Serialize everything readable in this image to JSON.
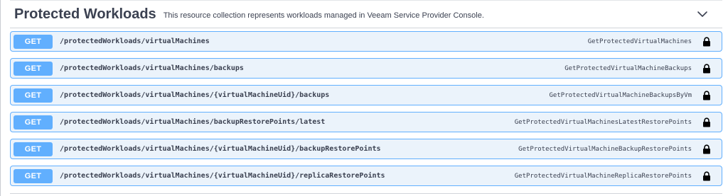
{
  "section": {
    "title": "Protected Workloads",
    "description": "This resource collection represents workloads managed in Veeam Service Provider Console.",
    "collapse_icon": "chevron-down-icon"
  },
  "colors": {
    "get_method": "#61affe",
    "row_background": "#ebf3fb",
    "text": "#3b4151"
  },
  "operations": [
    {
      "method": "GET",
      "path": "/protectedWorkloads/virtualMachines",
      "operation_id": "GetProtectedVirtualMachines",
      "icon": "lock-icon"
    },
    {
      "method": "GET",
      "path": "/protectedWorkloads/virtualMachines/backups",
      "operation_id": "GetProtectedVirtualMachineBackups",
      "icon": "lock-icon"
    },
    {
      "method": "GET",
      "path": "/protectedWorkloads/virtualMachines/{virtualMachineUid}/backups",
      "operation_id": "GetProtectedVirtualMachineBackupsByVm",
      "icon": "lock-icon"
    },
    {
      "method": "GET",
      "path": "/protectedWorkloads/virtualMachines/backupRestorePoints/latest",
      "operation_id": "GetProtectedVirtualMachinesLatestRestorePoints",
      "icon": "lock-icon"
    },
    {
      "method": "GET",
      "path": "/protectedWorkloads/virtualMachines/{virtualMachineUid}/backupRestorePoints",
      "operation_id": "GetProtectedVirtualMachineBackupRestorePoints",
      "icon": "lock-icon"
    },
    {
      "method": "GET",
      "path": "/protectedWorkloads/virtualMachines/{virtualMachineUid}/replicaRestorePoints",
      "operation_id": "GetProtectedVirtualMachineReplicaRestorePoints",
      "icon": "lock-icon"
    }
  ]
}
